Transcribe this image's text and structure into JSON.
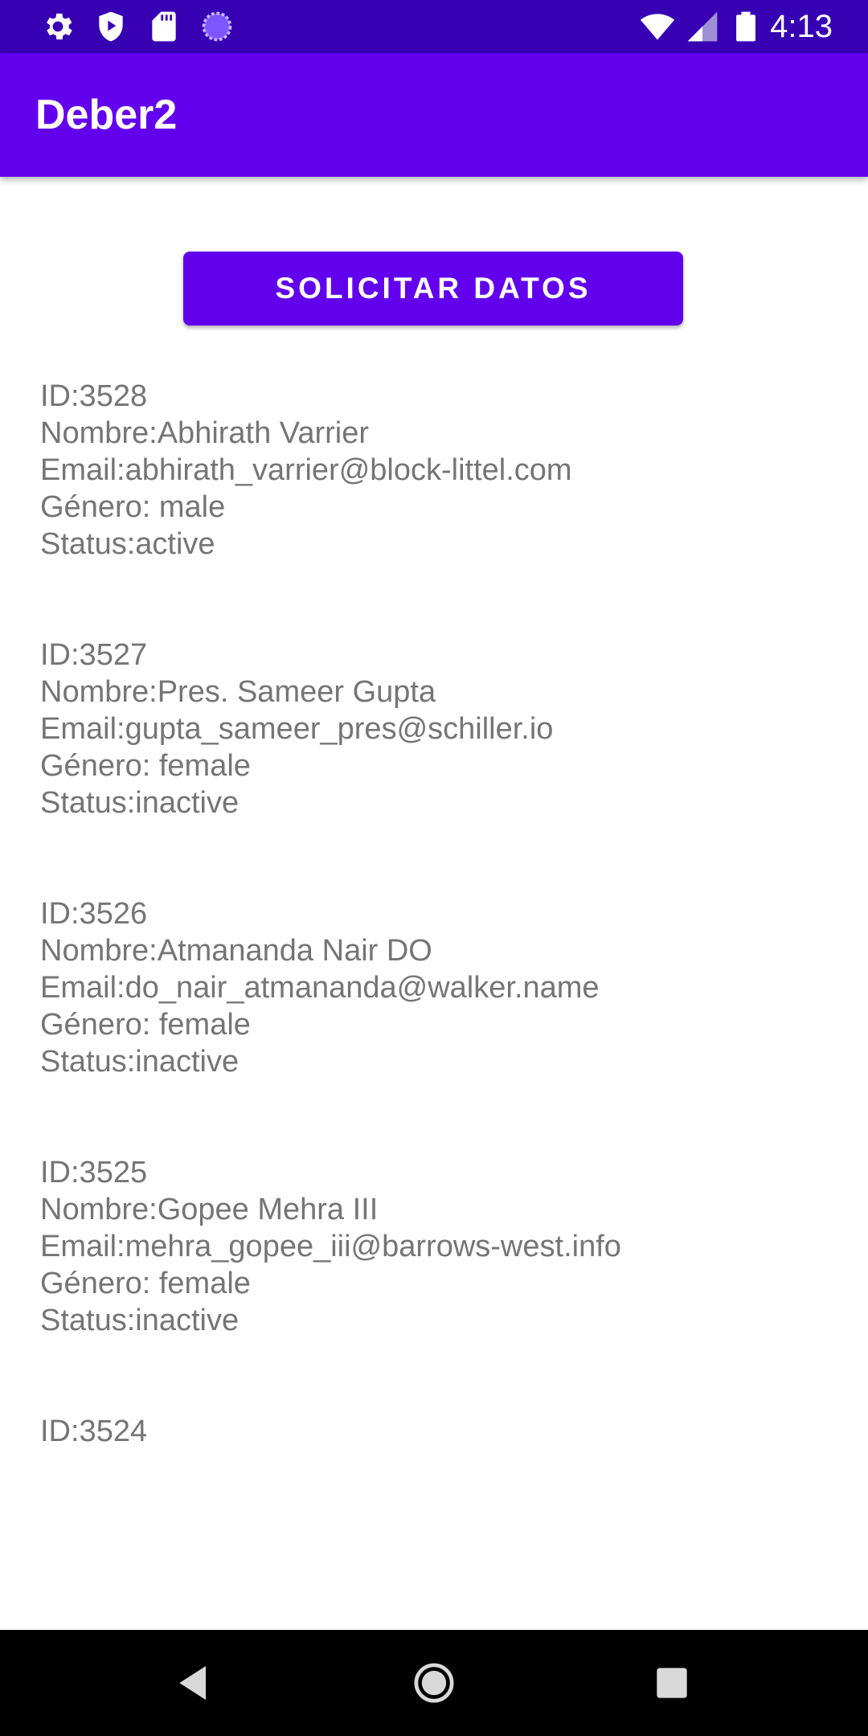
{
  "status_bar": {
    "time": "4:13",
    "left_icons": [
      "gear-icon",
      "shield-play-icon",
      "sd-card-icon",
      "spinner-icon"
    ],
    "right_icons": [
      "wifi-icon",
      "signal-icon",
      "battery-icon"
    ]
  },
  "app_bar": {
    "title": "Deber2"
  },
  "actions": {
    "request_button_label": "SOLICITAR DATOS"
  },
  "records": [
    {
      "id": "ID:3528",
      "name": "Nombre:Abhirath Varrier",
      "email": "Email:abhirath_varrier@block-littel.com",
      "gender": "Género: male",
      "status": "Status:active"
    },
    {
      "id": "ID:3527",
      "name": "Nombre:Pres. Sameer Gupta",
      "email": "Email:gupta_sameer_pres@schiller.io",
      "gender": "Género: female",
      "status": "Status:inactive"
    },
    {
      "id": "ID:3526",
      "name": "Nombre:Atmananda Nair DO",
      "email": "Email:do_nair_atmananda@walker.name",
      "gender": "Género: female",
      "status": "Status:inactive"
    },
    {
      "id": "ID:3525",
      "name": "Nombre:Gopee Mehra III",
      "email": "Email:mehra_gopee_iii@barrows-west.info",
      "gender": "Género: female",
      "status": "Status:inactive"
    },
    {
      "id": "ID:3524"
    }
  ],
  "navigation": {
    "icons": [
      "back-icon",
      "home-icon",
      "recents-icon"
    ]
  },
  "colors": {
    "status_bar": "#3700b3",
    "primary": "#6200ee",
    "text": "#757575",
    "nav_bar": "#000000"
  }
}
